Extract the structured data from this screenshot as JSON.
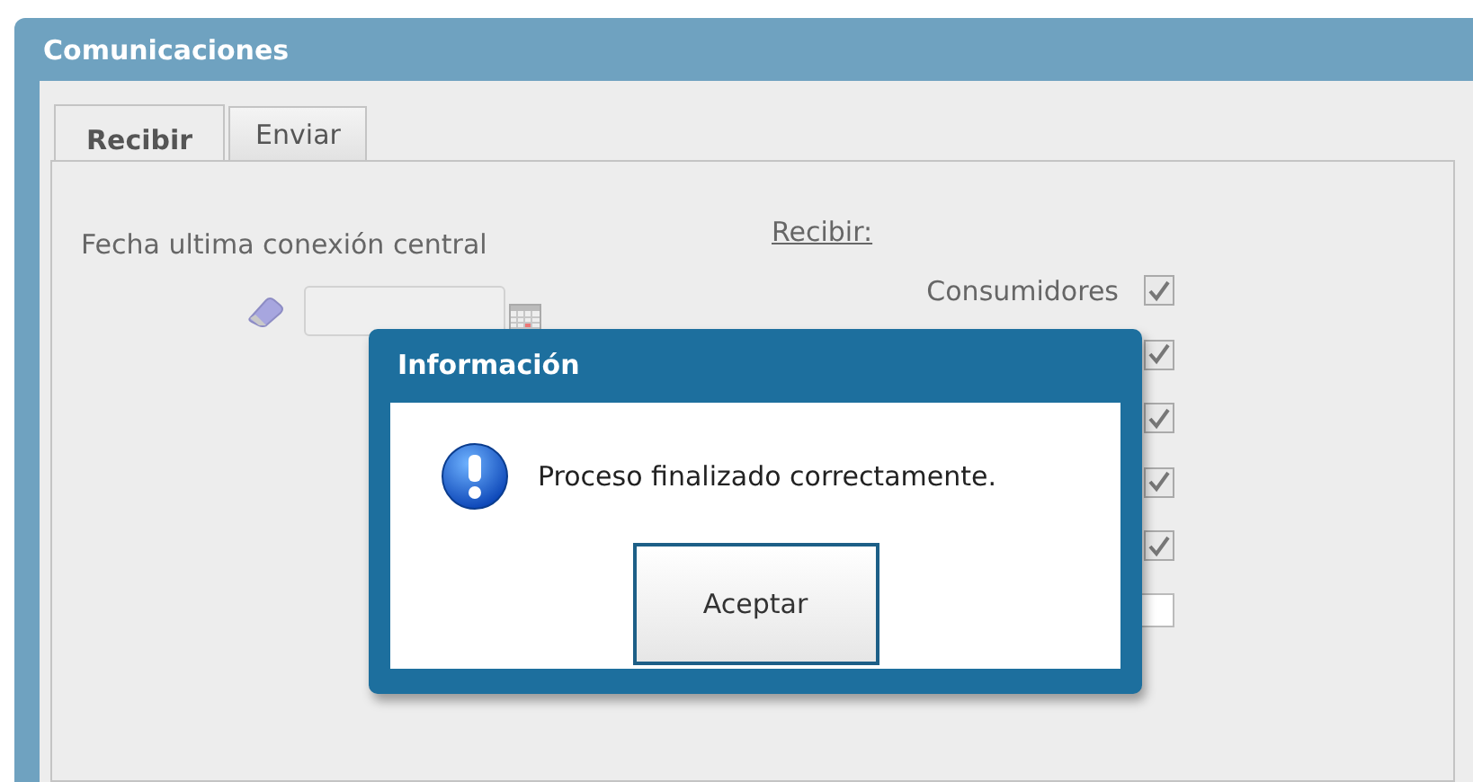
{
  "window": {
    "title": "Comunicaciones"
  },
  "tabs": [
    {
      "label": "Recibir",
      "selected": true
    },
    {
      "label": "Enviar",
      "selected": false
    }
  ],
  "date_field": {
    "label": "Fecha ultima conexión central"
  },
  "receive": {
    "heading": "Recibir:",
    "options": [
      {
        "label": "Consumidores",
        "checked": true
      },
      {
        "checked": true
      },
      {
        "checked": true
      },
      {
        "checked": true
      },
      {
        "checked": true
      },
      {
        "checked": false
      }
    ]
  },
  "dialog": {
    "title": "Información",
    "message": "Proceso finalizado correctamente.",
    "button": "Aceptar"
  }
}
